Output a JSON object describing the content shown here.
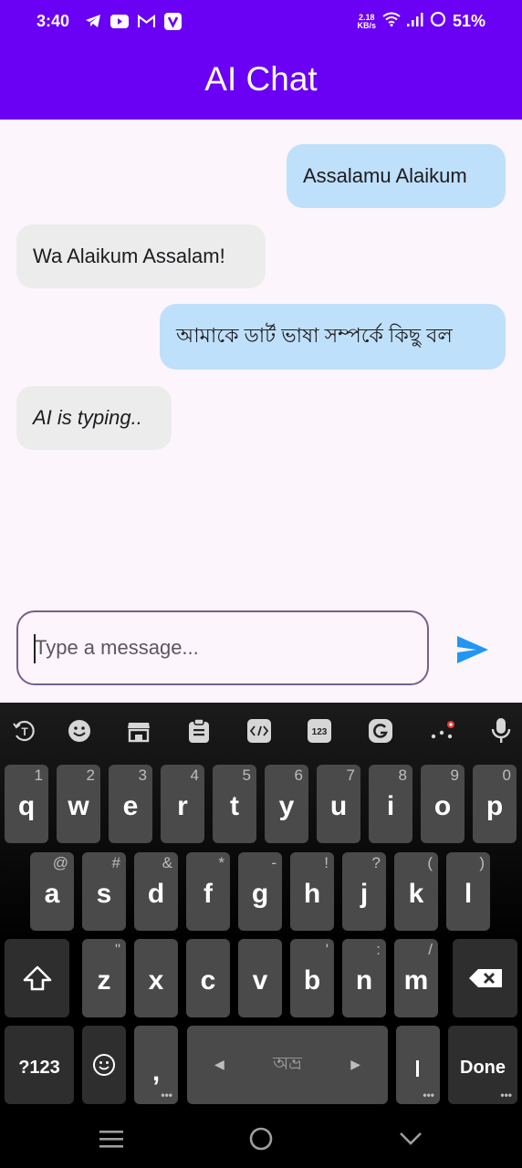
{
  "status_bar": {
    "time": "3:40",
    "net_speed": "2.18",
    "net_unit": "KB/s",
    "battery": "51%",
    "notification_icons": [
      "telegram-icon",
      "youtube-icon",
      "gmail-icon",
      "v-app-icon"
    ]
  },
  "app_bar": {
    "title": "AI Chat",
    "color": "#6a00f4"
  },
  "messages": [
    {
      "role": "user",
      "text": "Assalamu Alaikum"
    },
    {
      "role": "ai",
      "text": "Wa Alaikum Assalam!"
    },
    {
      "role": "user",
      "text": "আমাকে ডার্ট ভাষা সম্পর্কে কিছু বল"
    },
    {
      "role": "ai",
      "text": "AI is typing..",
      "typing": true
    }
  ],
  "composer": {
    "placeholder": "Type a message...",
    "value": ""
  },
  "keyboard": {
    "toolbar": [
      "translate-icon",
      "emoji-icon",
      "store-icon",
      "clipboard-icon",
      "text-edit-icon",
      "numpad-icon",
      "grammarly-icon",
      "more-icon",
      "microphone-icon"
    ],
    "toolbar_numpad_label": "123",
    "row1": [
      {
        "key": "q",
        "hint": "1"
      },
      {
        "key": "w",
        "hint": "2"
      },
      {
        "key": "e",
        "hint": "3"
      },
      {
        "key": "r",
        "hint": "4"
      },
      {
        "key": "t",
        "hint": "5"
      },
      {
        "key": "y",
        "hint": "6"
      },
      {
        "key": "u",
        "hint": "7"
      },
      {
        "key": "i",
        "hint": "8"
      },
      {
        "key": "o",
        "hint": "9"
      },
      {
        "key": "p",
        "hint": "0"
      }
    ],
    "row2": [
      {
        "key": "a",
        "hint": "@"
      },
      {
        "key": "s",
        "hint": "#"
      },
      {
        "key": "d",
        "hint": "&"
      },
      {
        "key": "f",
        "hint": "*"
      },
      {
        "key": "g",
        "hint": "-"
      },
      {
        "key": "h",
        "hint": "!"
      },
      {
        "key": "j",
        "hint": "?"
      },
      {
        "key": "k",
        "hint": "("
      },
      {
        "key": "l",
        "hint": ")"
      }
    ],
    "row3": [
      {
        "key": "z",
        "hint": "\""
      },
      {
        "key": "x",
        "hint": ""
      },
      {
        "key": "c",
        "hint": ""
      },
      {
        "key": "v",
        "hint": ""
      },
      {
        "key": "b",
        "hint": "'"
      },
      {
        "key": "n",
        "hint": ":"
      },
      {
        "key": "m",
        "hint": "/"
      }
    ],
    "symbols_label": "?123",
    "comma": ",",
    "space_label": "অভ্র",
    "period": ".",
    "done_label": "Done"
  }
}
